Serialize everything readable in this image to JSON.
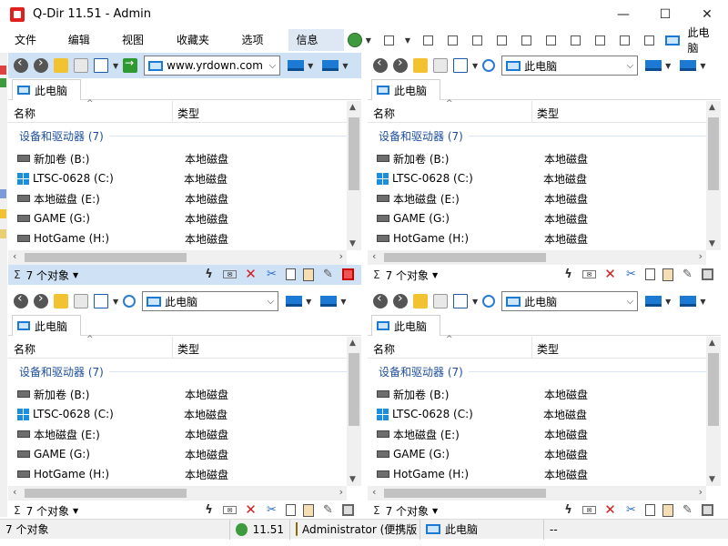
{
  "window": {
    "title": "Q-Dir 11.51 - Admin",
    "minimize_glyph": "—",
    "maximize_glyph": "☐",
    "close_glyph": "✕"
  },
  "menu": {
    "items": [
      "文件 (F)",
      "编辑 (E)",
      "视图 (V)",
      "收藏夹 (A)",
      "选项 (X)",
      "信息 (H)"
    ],
    "right_label": "此电脑"
  },
  "panes": [
    {
      "address": "www.yrdown.com",
      "tab_label": "此电脑",
      "columns": {
        "name": "名称",
        "type": "类型"
      },
      "group": "设备和驱动器 (7)",
      "rows": [
        {
          "name": "新加卷 (B:)",
          "type": "本地磁盘",
          "icon": "drive-icon"
        },
        {
          "name": "LTSC-0628 (C:)",
          "type": "本地磁盘",
          "icon": "windows-drive-icon"
        },
        {
          "name": "本地磁盘 (E:)",
          "type": "本地磁盘",
          "icon": "drive-icon"
        },
        {
          "name": "GAME (G:)",
          "type": "本地磁盘",
          "icon": "drive-icon"
        },
        {
          "name": "HotGame (H:)",
          "type": "本地磁盘",
          "icon": "drive-icon"
        }
      ],
      "status": "7 个对象",
      "active": true
    },
    {
      "address": "此电脑",
      "tab_label": "此电脑",
      "columns": {
        "name": "名称",
        "type": "类型"
      },
      "group": "设备和驱动器 (7)",
      "rows": [
        {
          "name": "新加卷 (B:)",
          "type": "本地磁盘",
          "icon": "drive-icon"
        },
        {
          "name": "LTSC-0628 (C:)",
          "type": "本地磁盘",
          "icon": "windows-drive-icon"
        },
        {
          "name": "本地磁盘 (E:)",
          "type": "本地磁盘",
          "icon": "drive-icon"
        },
        {
          "name": "GAME (G:)",
          "type": "本地磁盘",
          "icon": "drive-icon"
        },
        {
          "name": "HotGame (H:)",
          "type": "本地磁盘",
          "icon": "drive-icon"
        }
      ],
      "status": "7 个对象",
      "active": false
    },
    {
      "address": "此电脑",
      "tab_label": "此电脑",
      "columns": {
        "name": "名称",
        "type": "类型"
      },
      "group": "设备和驱动器 (7)",
      "rows": [
        {
          "name": "新加卷 (B:)",
          "type": "本地磁盘",
          "icon": "drive-icon"
        },
        {
          "name": "LTSC-0628 (C:)",
          "type": "本地磁盘",
          "icon": "windows-drive-icon"
        },
        {
          "name": "本地磁盘 (E:)",
          "type": "本地磁盘",
          "icon": "drive-icon"
        },
        {
          "name": "GAME (G:)",
          "type": "本地磁盘",
          "icon": "drive-icon"
        },
        {
          "name": "HotGame (H:)",
          "type": "本地磁盘",
          "icon": "drive-icon"
        }
      ],
      "status": "7 个对象",
      "active": false
    },
    {
      "address": "此电脑",
      "tab_label": "此电脑",
      "columns": {
        "name": "名称",
        "type": "类型"
      },
      "group": "设备和驱动器 (7)",
      "rows": [
        {
          "name": "新加卷 (B:)",
          "type": "本地磁盘",
          "icon": "drive-icon"
        },
        {
          "name": "LTSC-0628 (C:)",
          "type": "本地磁盘",
          "icon": "windows-drive-icon"
        },
        {
          "name": "本地磁盘 (E:)",
          "type": "本地磁盘",
          "icon": "drive-icon"
        },
        {
          "name": "GAME (G:)",
          "type": "本地磁盘",
          "icon": "drive-icon"
        },
        {
          "name": "HotGame (H:)",
          "type": "本地磁盘",
          "icon": "drive-icon"
        }
      ],
      "status": "7 个对象",
      "active": false
    }
  ],
  "statusbar": {
    "objects": "7 个对象",
    "version": "11.51",
    "user": "Administrator (便携版",
    "location": "此电脑",
    "extra": "--"
  },
  "colors": {
    "active_pane_highlight": "#cfe1f4",
    "group_header": "#1e4f9c",
    "delete_red": "#d21f1f",
    "accent_blue": "#1d7ad4"
  }
}
